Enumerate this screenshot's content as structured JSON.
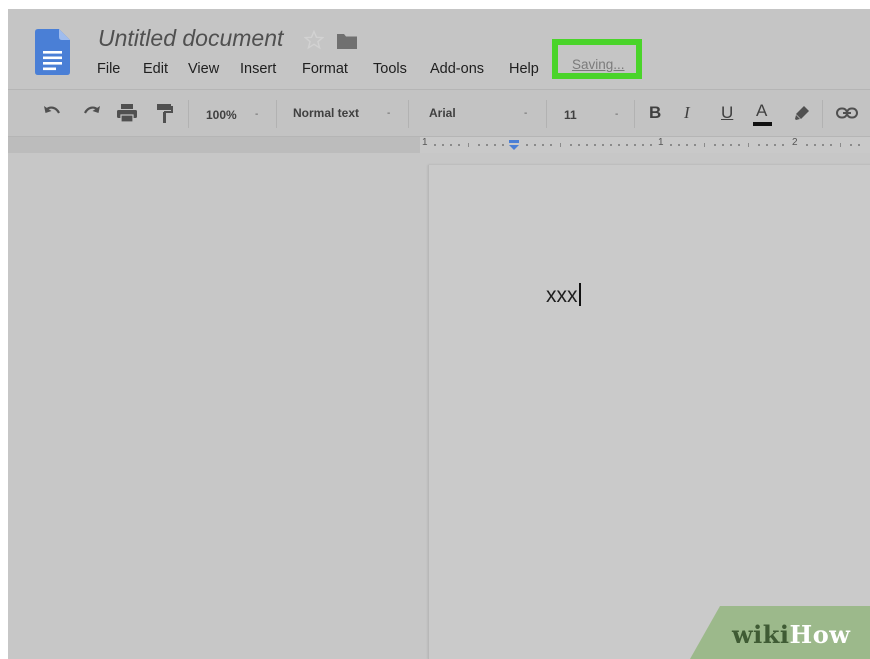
{
  "document": {
    "title": "Untitled document",
    "status": "Saving...",
    "body_text": "xxx"
  },
  "menu": {
    "items": [
      "File",
      "Edit",
      "View",
      "Insert",
      "Format",
      "Tools",
      "Add-ons",
      "Help"
    ]
  },
  "toolbar": {
    "zoom": "100%",
    "style": "Normal text",
    "font": "Arial",
    "size": "11",
    "bold": "B",
    "italic": "I",
    "underline": "U",
    "text_color": "A"
  },
  "ruler": {
    "labels": [
      "1",
      "1",
      "2"
    ]
  },
  "watermark": {
    "part1": "wiki",
    "part2": "How"
  },
  "colors": {
    "highlight": "#4ad42a",
    "docs_blue": "#4a7fd6"
  }
}
